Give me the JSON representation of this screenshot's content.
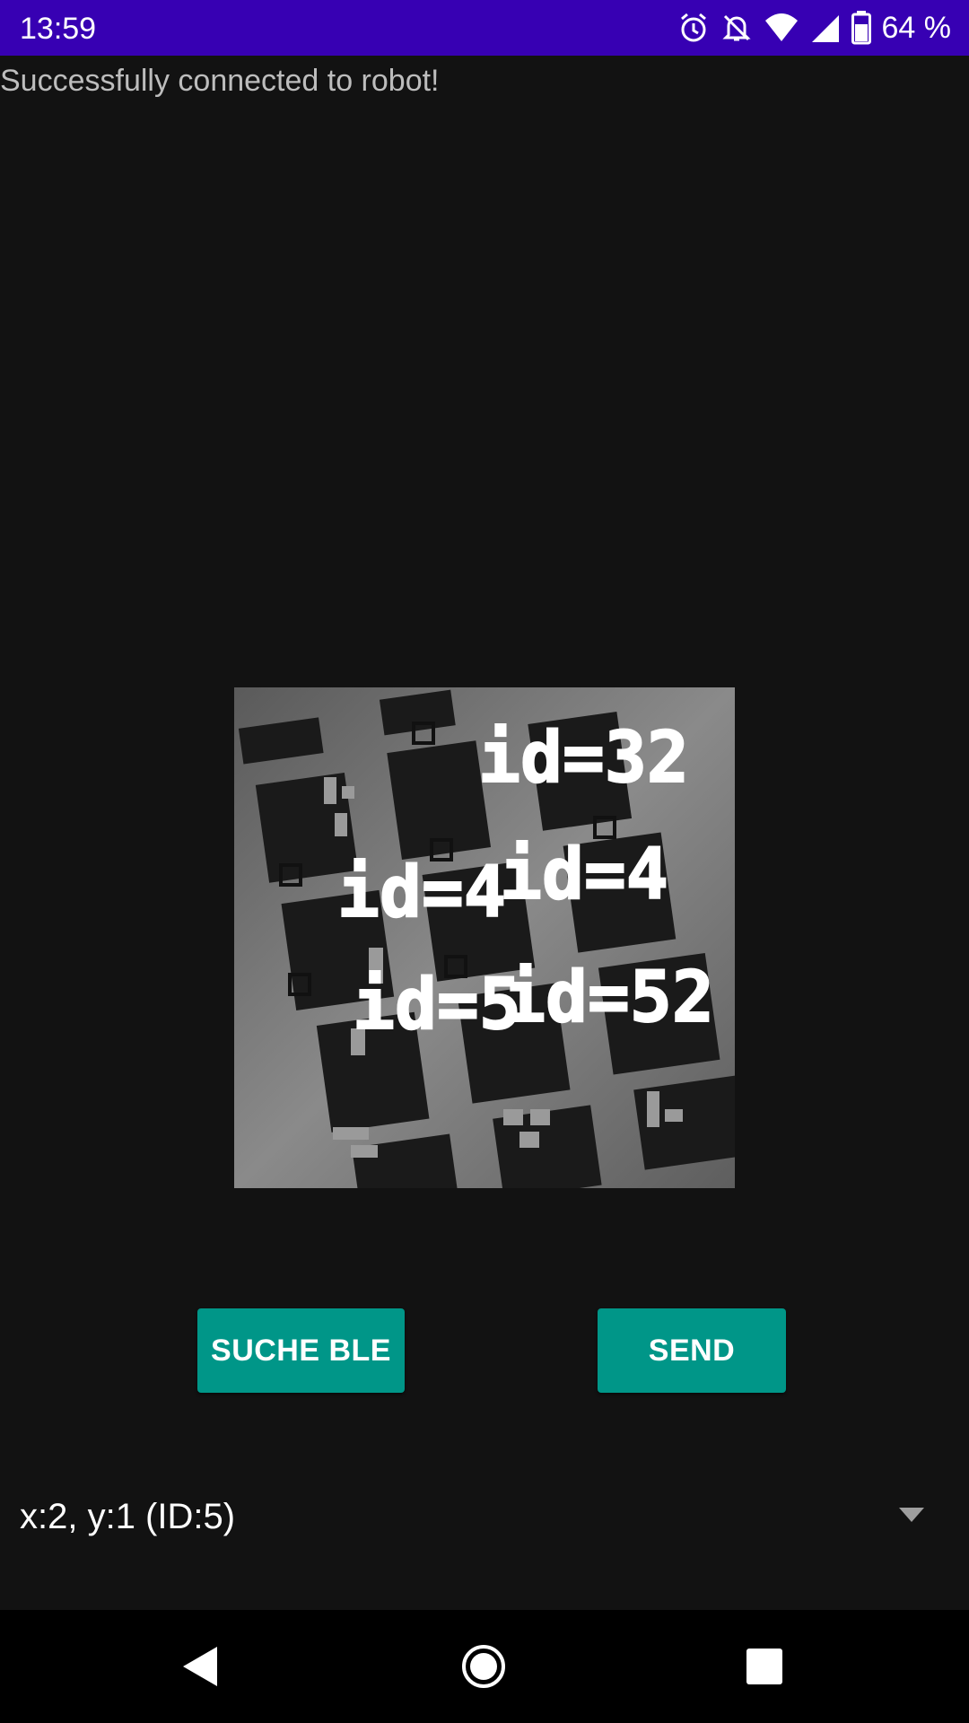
{
  "status_bar": {
    "time": "13:59",
    "battery_text": "64 %",
    "icons": [
      "alarm-icon",
      "bell-off-icon",
      "wifi-icon",
      "signal-icon",
      "battery-icon"
    ]
  },
  "status_message": "Successfully connected to robot!",
  "preview": {
    "marker_labels": [
      "id=32",
      "id=4",
      "id=4",
      "id=5",
      "id=52"
    ]
  },
  "buttons": {
    "search_label": "SUCHE BLE",
    "send_label": "SEND"
  },
  "spinner": {
    "selected": "x:2, y:1 (ID:5)"
  },
  "colors": {
    "status_bar": "#3700b3",
    "background": "#121212",
    "accent": "#009688"
  }
}
